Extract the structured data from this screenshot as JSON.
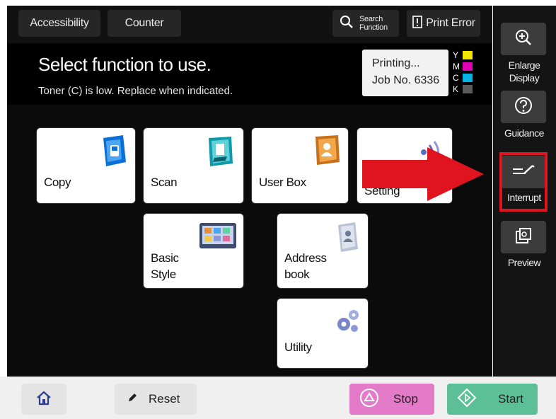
{
  "topbar": {
    "accessibility_label": "Accessibility",
    "counter_label": "Counter",
    "search_label_line1": "Search",
    "search_label_line2": "Function",
    "print_error_label": "Print Error"
  },
  "message": {
    "title": "Select function to use.",
    "subtitle": "Toner (C) is low. Replace when indicated."
  },
  "job_status": {
    "line1": "Printing...",
    "line2": "Job No. 6336"
  },
  "toner": [
    {
      "label": "Y",
      "color": "#f5e600"
    },
    {
      "label": "M",
      "color": "#e000b4"
    },
    {
      "label": "C",
      "color": "#00b4e6"
    },
    {
      "label": "K",
      "color": "#5a5a5a"
    }
  ],
  "tiles": {
    "copy": "Copy",
    "scan": "Scan",
    "user_box": "User Box",
    "setting": "Setting",
    "basic_style_line1": "Basic",
    "basic_style_line2": "Style",
    "address_book_line1": "Address",
    "address_book_line2": "book",
    "utility": "Utility"
  },
  "sidebar": {
    "enlarge_line1": "Enlarge",
    "enlarge_line2": "Display",
    "guidance": "Guidance",
    "interrupt": "Interrupt",
    "preview": "Preview"
  },
  "bottombar": {
    "reset_label": "Reset",
    "stop_label": "Stop",
    "start_label": "Start"
  },
  "colors": {
    "highlight": "#e0141e",
    "stop_button": "#e47bc8",
    "start_button": "#5cbf98"
  },
  "icons": [
    "home-icon",
    "pencil-icon",
    "stop-icon",
    "start-icon",
    "zoom-in-icon",
    "question-icon",
    "interrupt-icon",
    "preview-icon",
    "search-icon",
    "print-error-icon"
  ]
}
